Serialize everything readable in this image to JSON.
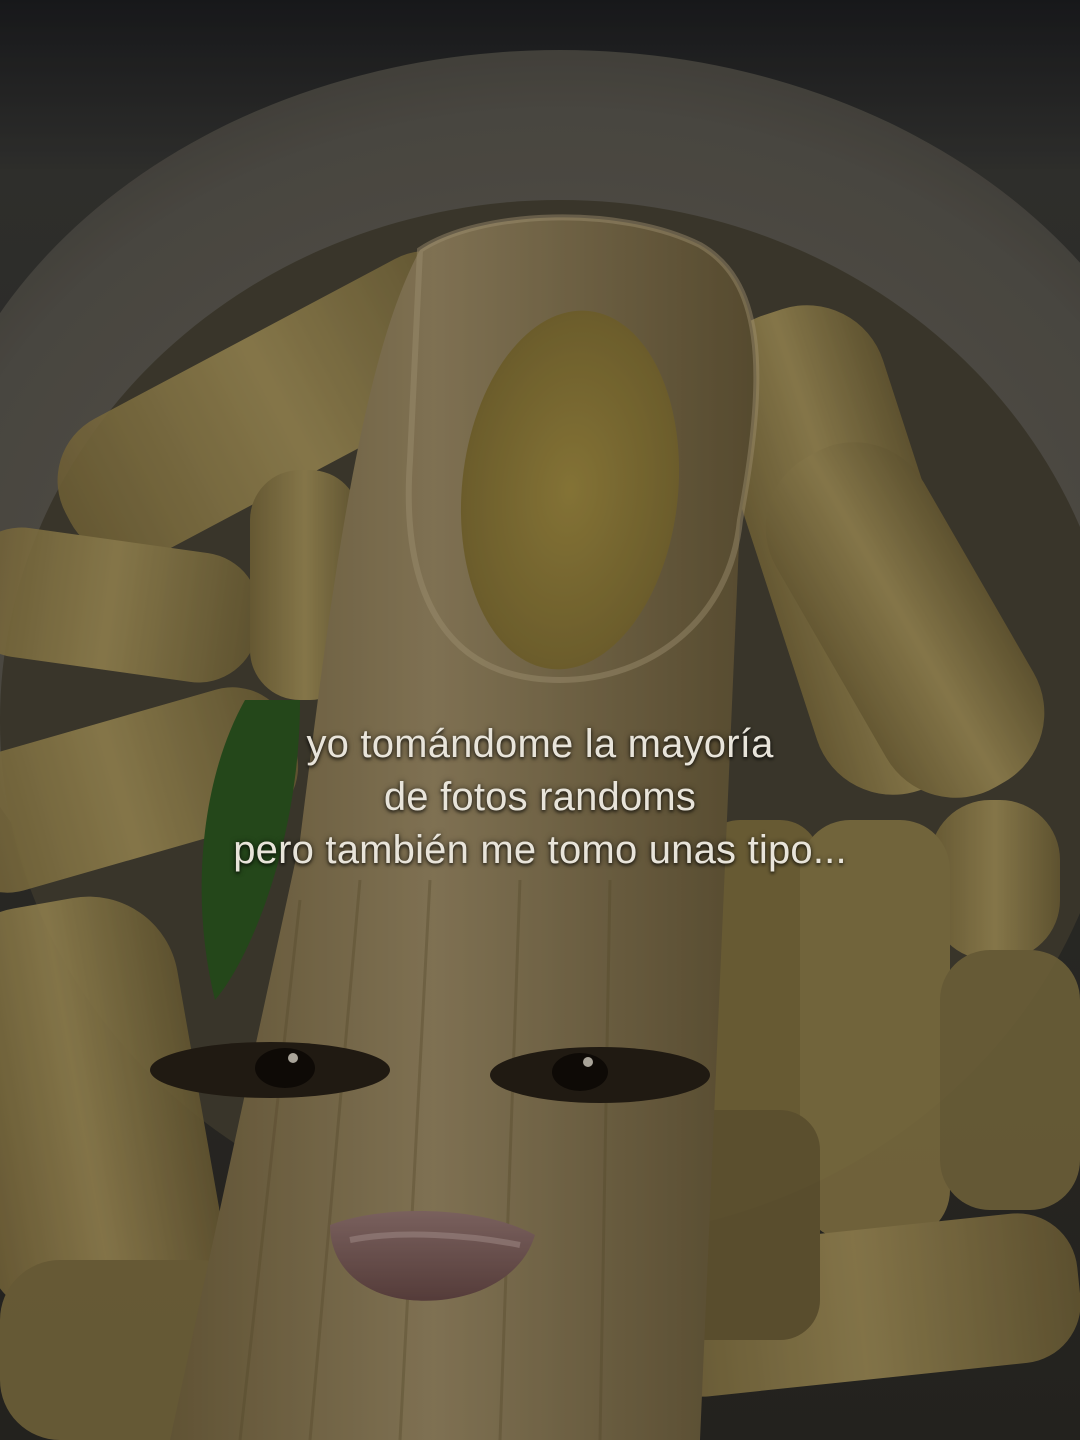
{
  "caption": {
    "line1": "yo tomándome la mayoría",
    "line2": "de fotos randoms",
    "line3": "pero también me tomo unas tipo..."
  },
  "scene": {
    "subject": "penne-pasta-with-face",
    "overlay_tint": "#000000"
  }
}
